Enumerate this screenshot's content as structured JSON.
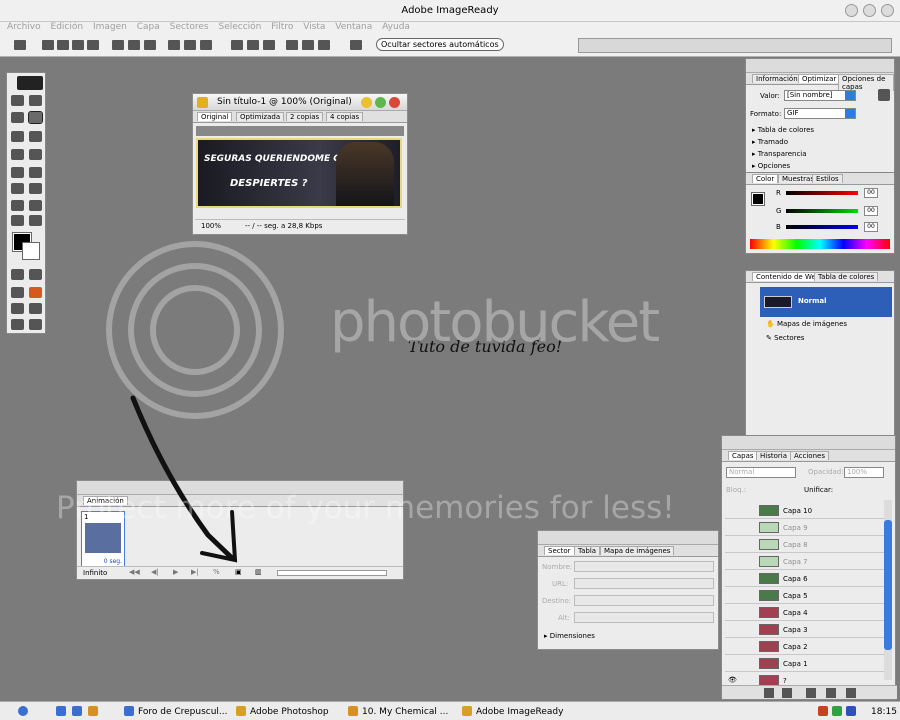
{
  "app": {
    "title": "Adobe ImageReady"
  },
  "menu": [
    "Archivo",
    "Edición",
    "Imagen",
    "Capa",
    "Sectores",
    "Selección",
    "Filtro",
    "Vista",
    "Ventana",
    "Ayuda"
  ],
  "options_bar": {
    "auto_slices_label": "Ocultar sectores automáticos"
  },
  "doc_window": {
    "title": "Sin título-1 @ 100% (Original)",
    "tabs": [
      "Original",
      "Optimizada",
      "2 copias",
      "4 copias"
    ],
    "banner_line1": "SEGURAS QUERIENDOME CUANDO",
    "banner_line2": "DESPIERTES ?",
    "zoom": "100%",
    "speed": "-- / -- seg. a 28,8 Kbps"
  },
  "info_panel": {
    "tabs": [
      "Información",
      "Optimizar",
      "Opciones de capas"
    ],
    "value_label": "Valor:",
    "value": "[Sin nombre]",
    "format_label": "Formato:",
    "format": "GIF",
    "sections": [
      "Tabla de colores",
      "Tramado",
      "Transparencia",
      "Opciones"
    ]
  },
  "color_panel": {
    "tabs": [
      "Color",
      "Muestras",
      "Estilos"
    ],
    "channels": [
      {
        "label": "R",
        "value": "00",
        "color": "#cc0000"
      },
      {
        "label": "G",
        "value": "00",
        "color": "#00aa00"
      },
      {
        "label": "B",
        "value": "00",
        "color": "#0000cc"
      }
    ]
  },
  "web_panel": {
    "tabs": [
      "Contenido de Web",
      "Tabla de colores"
    ],
    "items": [
      "Normal",
      "Mapas de imágenes",
      "Sectores"
    ]
  },
  "layers_panel": {
    "tabs": [
      "Capas",
      "Historia",
      "Acciones"
    ],
    "mode": "Normal",
    "opacity_label": "Opacidad:",
    "opacity": "100%",
    "lock_label": "Bloq.:",
    "unify_label": "Unificar:",
    "layers": [
      {
        "name": "Capa 10",
        "dim": false
      },
      {
        "name": "Capa 9",
        "dim": true
      },
      {
        "name": "Capa 8",
        "dim": true
      },
      {
        "name": "Capa 7",
        "dim": true
      },
      {
        "name": "Capa 6",
        "dim": false
      },
      {
        "name": "Capa 5",
        "dim": false
      },
      {
        "name": "Capa 4",
        "dim": false
      },
      {
        "name": "Capa 3",
        "dim": false
      },
      {
        "name": "Capa 2",
        "dim": false
      },
      {
        "name": "Capa 1",
        "dim": false
      },
      {
        "name": "?",
        "dim": false
      }
    ]
  },
  "animation_panel": {
    "tab": "Animación",
    "frame_number": "1",
    "frame_delay": "0 seg.",
    "loop": "Infinito"
  },
  "slice_panel": {
    "tabs": [
      "Sector",
      "Tabla",
      "Mapa de imágenes"
    ],
    "fields": [
      "Nombre:",
      "URL:",
      "Destino:",
      "Alt:"
    ],
    "dimensions": "Dimensiones"
  },
  "canvas_text": "Tuto de tuvida feo!",
  "watermark": {
    "brand": "photobucket",
    "tagline": "Protect more of your memories for less!"
  },
  "taskbar": {
    "tasks": [
      "Foro de Crepuscul...",
      "Adobe Photoshop",
      "10. My Chemical ...",
      "Adobe ImageReady"
    ],
    "clock": "18:15"
  }
}
